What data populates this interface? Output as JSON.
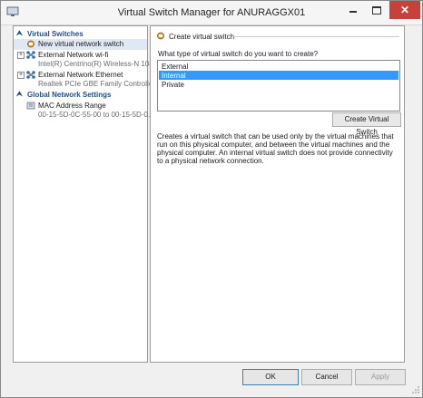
{
  "window": {
    "title": "Virtual Switch Manager for ANURAGGX01",
    "close_glyph": "✕"
  },
  "left_pane": {
    "virtual_switches": {
      "header": "Virtual Switches",
      "items": [
        {
          "label": "New virtual network switch",
          "sub": ""
        },
        {
          "label": "External Network wi-fi",
          "sub": "Intel(R) Centrino(R) Wireless-N 1030"
        },
        {
          "label": "External Network Ethernet",
          "sub": "Realtek PCIe GBE Family Controller"
        }
      ]
    },
    "global": {
      "header": "Global Network Settings",
      "items": [
        {
          "label": "MAC Address Range",
          "sub": "00-15-5D-0C-55-00 to 00-15-5D-0..."
        }
      ]
    }
  },
  "right_pane": {
    "section_title": "Create virtual switch",
    "question": "What type of virtual switch do you want to create?",
    "options": [
      "External",
      "Internal",
      "Private"
    ],
    "selected_option": "Internal",
    "create_button": "Create Virtual Switch",
    "description": "Creates a virtual switch that can be used only by the virtual machines that run on this physical computer, and between the virtual machines and the physical computer. An internal virtual switch does not provide connectivity to a physical network connection."
  },
  "footer": {
    "ok": "OK",
    "cancel": "Cancel",
    "apply": "Apply"
  },
  "colors": {
    "selection": "#3399ff",
    "header_text": "#1f4e8c",
    "close_button": "#c7413b"
  }
}
